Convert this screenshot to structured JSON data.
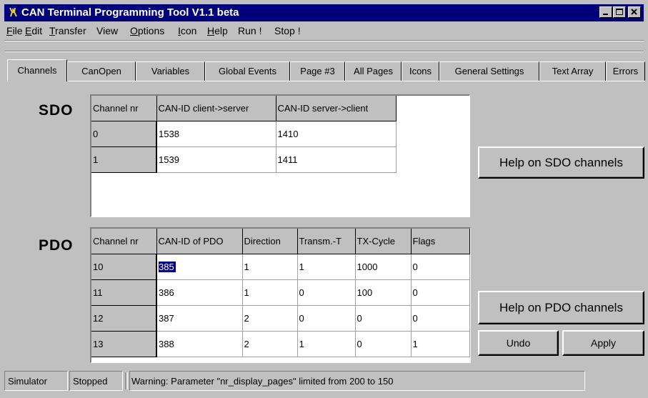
{
  "window": {
    "title": "CAN Terminal Programming Tool V1.1 beta"
  },
  "menu": [
    "File",
    "Edit",
    "Transfer",
    "View",
    "Options",
    "Icon",
    "Help",
    "Run !",
    "Stop !"
  ],
  "tabs": [
    "Channels",
    "CanOpen",
    "Variables",
    "Global Events",
    "Page #3",
    "All Pages",
    "Icons",
    "General Settings",
    "Text Array",
    "Errors"
  ],
  "sdo": {
    "label": "SDO",
    "headers": [
      "Channel nr",
      "CAN-ID client->server",
      "CAN-ID server->client"
    ],
    "rows": [
      [
        "0",
        "1538",
        "1410"
      ],
      [
        "1",
        "1539",
        "1411"
      ]
    ],
    "help_button": "Help on SDO channels"
  },
  "pdo": {
    "label": "PDO",
    "headers": [
      "Channel nr",
      "CAN-ID of PDO",
      "Direction",
      "Transm.-T",
      "TX-Cycle",
      "Flags"
    ],
    "rows": [
      [
        "10",
        "385",
        "1",
        "1",
        "1000",
        "0"
      ],
      [
        "11",
        "386",
        "1",
        "0",
        "100",
        "0"
      ],
      [
        "12",
        "387",
        "2",
        "0",
        "0",
        "0"
      ],
      [
        "13",
        "388",
        "2",
        "1",
        "0",
        "1"
      ]
    ],
    "help_button": "Help on PDO channels"
  },
  "buttons": {
    "undo": "Undo",
    "apply": "Apply"
  },
  "status": {
    "mode": "Simulator",
    "state": "Stopped",
    "message": "Warning: Parameter \"nr_display_pages\" limited from 200 to 150"
  },
  "colors": {
    "titlebar": "#00007b",
    "face": "#c0c0c0",
    "selection": "#000080"
  }
}
